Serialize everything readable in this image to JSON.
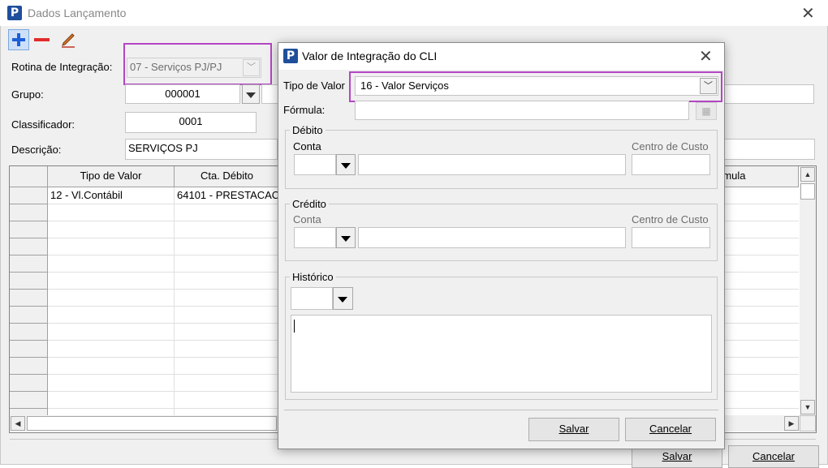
{
  "main": {
    "title": "Dados Lançamento",
    "toolbar": {
      "add": "add",
      "remove": "remove",
      "edit": "edit"
    },
    "labels": {
      "rotina": "Rotina de Integração:",
      "grupo": "Grupo:",
      "classificador": "Classificador:",
      "descricao": "Descrição:"
    },
    "values": {
      "rotina": "07 - Serviços PJ/PJ",
      "grupo": "000001",
      "classificador": "0001",
      "descricao": "SERVIÇOS PJ"
    },
    "grid": {
      "columns": [
        "Tipo de Valor",
        "Cta. Débito",
        "rmula"
      ],
      "rows": [
        [
          "12 - Vl.Contábil",
          "64101 - PRESTACAC",
          ""
        ]
      ]
    },
    "buttons": {
      "salvar": "Salvar",
      "cancelar": "Cancelar"
    }
  },
  "dialog": {
    "title": "Valor de Integração do CLI",
    "labels": {
      "tipo": "Tipo de Valor",
      "formula": "Fórmula:",
      "debito": "Débito",
      "credito": "Crédito",
      "conta": "Conta",
      "centro": "Centro de Custo",
      "historico": "Histórico"
    },
    "values": {
      "tipo": "16 - Valor Serviços"
    },
    "buttons": {
      "salvar": "Salvar",
      "cancelar": "Cancelar"
    }
  },
  "colors": {
    "accent": "#1f4f9b",
    "highlight": "#b346c3",
    "add": "#1e5ed8",
    "remove": "#e22b2b"
  }
}
